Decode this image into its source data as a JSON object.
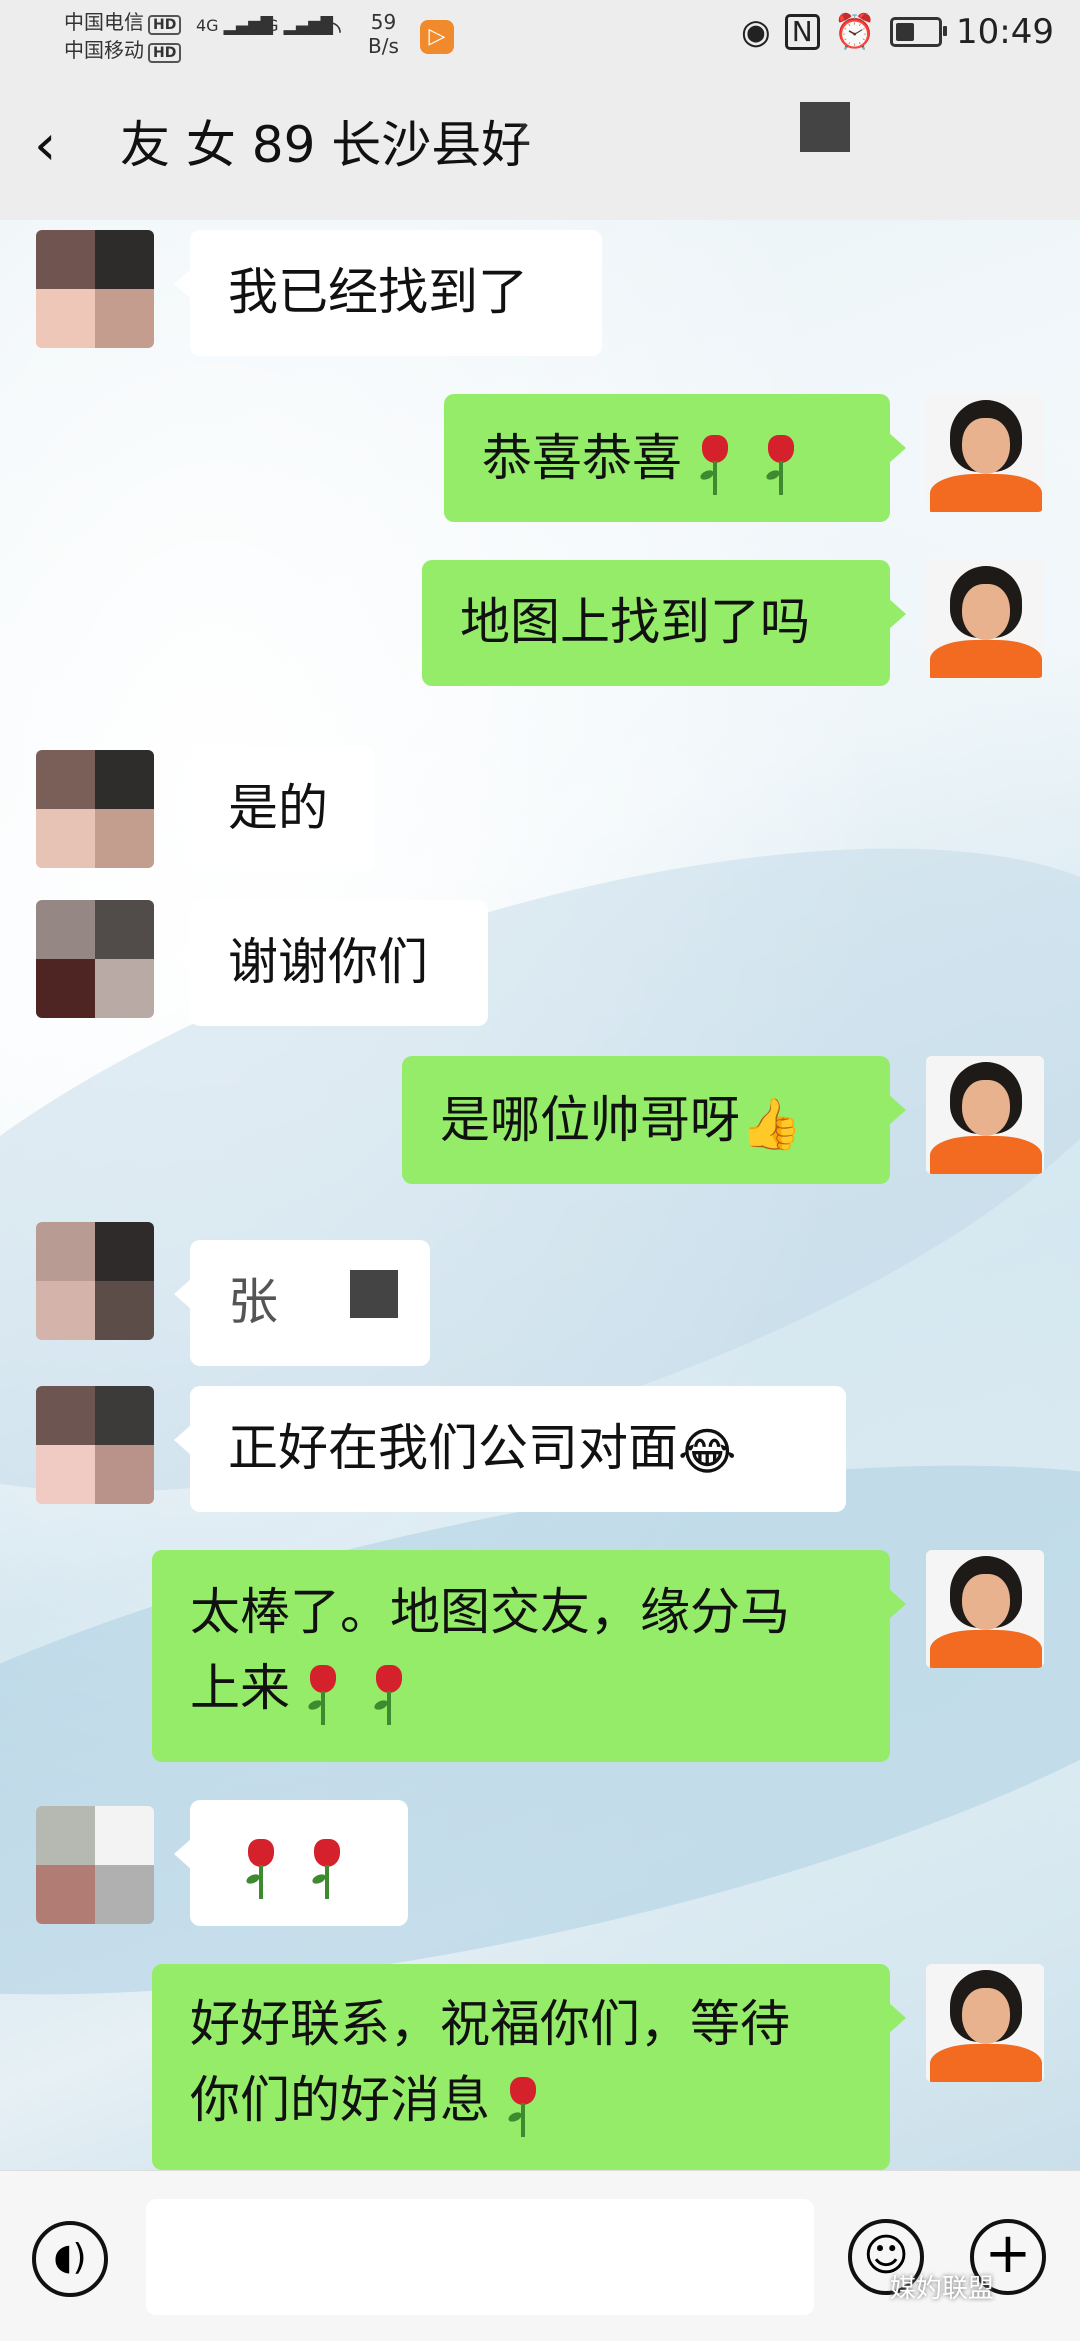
{
  "status_bar": {
    "carrier_1": "中国电信",
    "carrier_2": "中国移动",
    "hd_label": "HD",
    "network_1": "4G",
    "network_2": "4G",
    "speed_value": "59",
    "speed_unit": "B/s",
    "time": "10:49",
    "battery_level": 0.45,
    "icons": [
      "eye-icon",
      "nfc-icon",
      "alarm-icon",
      "battery-icon"
    ]
  },
  "header": {
    "back_icon": "chevron-left-icon",
    "title": "友 女 89 长沙县好"
  },
  "messages": [
    {
      "side": "in",
      "text": "我已经找到了"
    },
    {
      "side": "out",
      "text": "恭喜恭喜",
      "roses": 2
    },
    {
      "side": "out",
      "text": "地图上找到了吗"
    },
    {
      "side": "in",
      "text": "是的"
    },
    {
      "side": "in",
      "text": "谢谢你们"
    },
    {
      "side": "out",
      "text": "是哪位帅哥呀",
      "emoji": "thumbs-up"
    },
    {
      "side": "in",
      "text": "张"
    },
    {
      "side": "in",
      "text": "正好在我们公司对面",
      "emoji": "laughing-crying"
    },
    {
      "side": "out",
      "line1": "太棒了。地图交友，缘分马",
      "line2": "上来",
      "roses": 2
    },
    {
      "side": "in",
      "text": "",
      "roses": 2
    },
    {
      "side": "out",
      "line1": "好好联系，祝福你们，等待",
      "line2": "你们的好消息",
      "roses": 1
    }
  ],
  "input_bar": {
    "voice_icon": "voice-icon",
    "emoji_icon": "smiley-icon",
    "plus_icon": "plus-icon",
    "watermark": "媒妁联盟"
  },
  "colors": {
    "outgoing_bubble": "#95ec69",
    "incoming_bubble": "#ffffff",
    "header_bg": "#ededed"
  }
}
